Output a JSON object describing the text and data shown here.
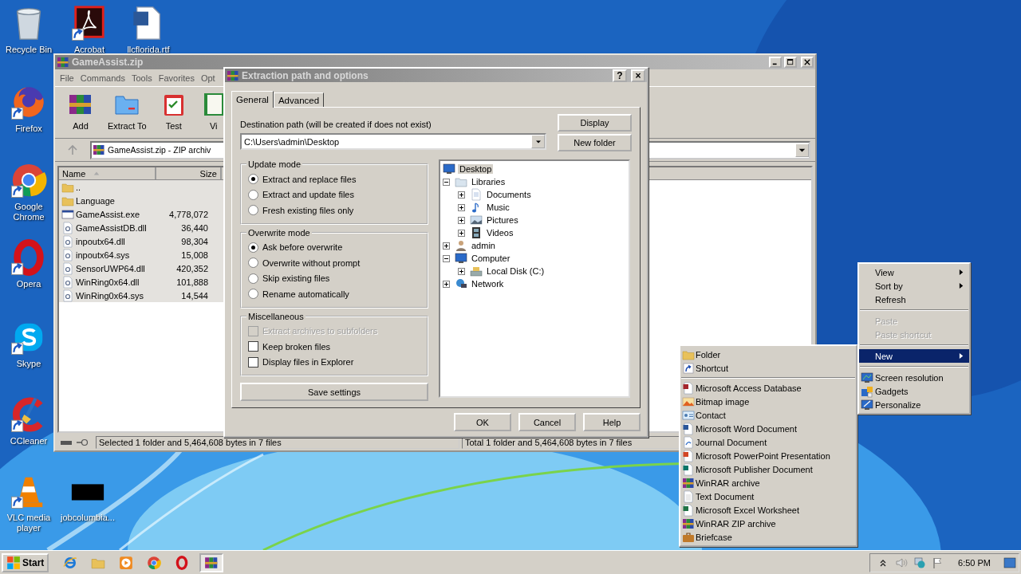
{
  "desktop_icons": [
    {
      "label": "Recycle Bin",
      "kind": "recycle",
      "shortcut": false
    },
    {
      "label": "Acrobat",
      "kind": "acrobat",
      "shortcut": true
    },
    {
      "label": "llcflorida.rtf",
      "kind": "worddoc",
      "shortcut": false
    },
    {
      "label": "Firefox",
      "kind": "firefox",
      "shortcut": true
    },
    {
      "label": "Google Chrome",
      "kind": "chrome",
      "shortcut": true
    },
    {
      "label": "Opera",
      "kind": "opera",
      "shortcut": true
    },
    {
      "label": "Skype",
      "kind": "skype",
      "shortcut": true
    },
    {
      "label": "CCleaner",
      "kind": "ccleaner",
      "shortcut": true
    },
    {
      "label": "VLC media player",
      "kind": "vlc",
      "shortcut": true
    },
    {
      "label": "jobcolumbia...",
      "kind": "thumb",
      "shortcut": false
    }
  ],
  "archive_window": {
    "title": "GameAssist.zip",
    "menu": [
      "File",
      "Commands",
      "Tools",
      "Favorites",
      "Opt"
    ],
    "toolbar": [
      {
        "label": "Add",
        "kind": "add"
      },
      {
        "label": "Extract To",
        "kind": "extract"
      },
      {
        "label": "Test",
        "kind": "test"
      },
      {
        "label": "Vi",
        "kind": "view"
      }
    ],
    "address": "GameAssist.zip - ZIP archiv",
    "columns": [
      {
        "label": "Name",
        "sorted": true
      },
      {
        "label": "Size",
        "sorted": false
      }
    ],
    "files": [
      {
        "name": "..",
        "kind": "folder",
        "selected": true
      },
      {
        "name": "Language",
        "kind": "folder",
        "selected": true
      },
      {
        "name": "GameAssist.exe",
        "size": "4,778,072",
        "kind": "exe",
        "selected": true
      },
      {
        "name": "GameAssistDB.dll",
        "size": "36,440",
        "kind": "dll",
        "selected": true
      },
      {
        "name": "inpoutx64.dll",
        "size": "98,304",
        "kind": "dll",
        "selected": true
      },
      {
        "name": "inpoutx64.sys",
        "size": "15,008",
        "kind": "dll",
        "selected": true
      },
      {
        "name": "SensorUWP64.dll",
        "size": "420,352",
        "kind": "dll",
        "selected": true
      },
      {
        "name": "WinRing0x64.dll",
        "size": "101,888",
        "kind": "dll",
        "selected": true
      },
      {
        "name": "WinRing0x64.sys",
        "size": "14,544",
        "kind": "dll",
        "selected": true
      }
    ],
    "status_left": "Selected 1 folder and 5,464,608 bytes in 7 files",
    "status_right": "Total 1 folder and 5,464,608 bytes in 7 files"
  },
  "dialog": {
    "title": "Extraction path and options",
    "title_buttons": [
      "?",
      "×"
    ],
    "tabs": [
      {
        "label": "General",
        "selected": true
      },
      {
        "label": "Advanced",
        "selected": false
      }
    ],
    "destination_label": "Destination path (will be created if does not exist)",
    "destination": "C:\\Users\\admin\\Desktop",
    "side_buttons": [
      "Display",
      "New folder"
    ],
    "groups": [
      {
        "title": "Update mode",
        "kind": "radio",
        "options": [
          {
            "label": "Extract and replace files",
            "selected": true
          },
          {
            "label": "Extract and update files",
            "selected": false
          },
          {
            "label": "Fresh existing files only",
            "selected": false
          }
        ]
      },
      {
        "title": "Overwrite mode",
        "kind": "radio",
        "options": [
          {
            "label": "Ask before overwrite",
            "selected": true
          },
          {
            "label": "Overwrite without prompt",
            "selected": false
          },
          {
            "label": "Skip existing files",
            "selected": false
          },
          {
            "label": "Rename automatically",
            "selected": false
          }
        ]
      },
      {
        "title": "Miscellaneous",
        "kind": "checkbox",
        "options": [
          {
            "label": "Extract archives to subfolders",
            "checked": false,
            "disabled": true
          },
          {
            "label": "Keep broken files",
            "checked": false,
            "disabled": false
          },
          {
            "label": "Display files in Explorer",
            "checked": false,
            "disabled": false
          }
        ]
      }
    ],
    "save_button": "Save settings",
    "tree": {
      "root": {
        "label": "Desktop",
        "selected": true
      },
      "nodes": [
        {
          "label": "Libraries",
          "kind": "libraries",
          "expanded": true,
          "selected": false,
          "children": [
            {
              "label": "Documents",
              "kind": "documents",
              "expanded": false,
              "selected": false
            },
            {
              "label": "Music",
              "kind": "music",
              "expanded": false,
              "selected": false
            },
            {
              "label": "Pictures",
              "kind": "pictures",
              "expanded": false,
              "selected": false
            },
            {
              "label": "Videos",
              "kind": "videos",
              "expanded": false,
              "selected": false
            }
          ]
        },
        {
          "label": "admin",
          "kind": "user",
          "expanded": false,
          "selected": false
        },
        {
          "label": "Computer",
          "kind": "computer",
          "expanded": true,
          "selected": false,
          "children": [
            {
              "label": "Local Disk (C:)",
              "kind": "disk",
              "expanded": false,
              "selected": false
            }
          ]
        },
        {
          "label": "Network",
          "kind": "network",
          "expanded": false,
          "selected": false
        }
      ]
    },
    "buttons": [
      "OK",
      "Cancel",
      "Help"
    ]
  },
  "context_menu": {
    "items": [
      {
        "label": "View",
        "kind": "plain",
        "submenu": true,
        "selected": false,
        "disabled": false
      },
      {
        "label": "Sort by",
        "kind": "plain",
        "submenu": true,
        "selected": false,
        "disabled": false
      },
      {
        "label": "Refresh",
        "kind": "plain",
        "submenu": false,
        "selected": false,
        "disabled": false
      },
      {
        "kind": "separator"
      },
      {
        "label": "Paste",
        "kind": "plain",
        "submenu": false,
        "selected": false,
        "disabled": true
      },
      {
        "label": "Paste shortcut",
        "kind": "plain",
        "submenu": false,
        "selected": false,
        "disabled": true
      },
      {
        "kind": "separator"
      },
      {
        "label": "New",
        "kind": "plain",
        "submenu": true,
        "selected": true,
        "disabled": false
      },
      {
        "kind": "separator"
      },
      {
        "label": "Screen resolution",
        "kind": "resolution",
        "submenu": false,
        "selected": false,
        "disabled": false
      },
      {
        "label": "Gadgets",
        "kind": "gadgets",
        "submenu": false,
        "selected": false,
        "disabled": false
      },
      {
        "label": "Personalize",
        "kind": "personalize",
        "submenu": false,
        "selected": false,
        "disabled": false
      }
    ]
  },
  "new_submenu": {
    "items": [
      {
        "label": "Folder",
        "kind": "folder"
      },
      {
        "label": "Shortcut",
        "kind": "shortcut"
      },
      {
        "kind": "separator"
      },
      {
        "label": "Microsoft Access Database",
        "kind": "access"
      },
      {
        "label": "Bitmap image",
        "kind": "bitmap"
      },
      {
        "label": "Contact",
        "kind": "contact"
      },
      {
        "label": "Microsoft Word Document",
        "kind": "word"
      },
      {
        "label": "Journal Document",
        "kind": "journal"
      },
      {
        "label": "Microsoft PowerPoint Presentation",
        "kind": "powerpoint"
      },
      {
        "label": "Microsoft Publisher Document",
        "kind": "publisher"
      },
      {
        "label": "WinRAR archive",
        "kind": "winrar"
      },
      {
        "label": "Text Document",
        "kind": "text"
      },
      {
        "label": "Microsoft Excel Worksheet",
        "kind": "excel"
      },
      {
        "label": "WinRAR ZIP archive",
        "kind": "winrar"
      },
      {
        "label": "Briefcase",
        "kind": "briefcase"
      }
    ]
  },
  "taskbar": {
    "start": "Start",
    "apps": [
      {
        "kind": "ie",
        "active": false
      },
      {
        "kind": "explorer",
        "active": false
      },
      {
        "kind": "mediaplayer",
        "active": false
      },
      {
        "kind": "chrome",
        "active": false
      },
      {
        "kind": "opera",
        "active": false
      },
      {
        "kind": "winrar",
        "active": true
      }
    ],
    "tray": [
      {
        "kind": "chevron"
      },
      {
        "kind": "volume"
      },
      {
        "kind": "network"
      },
      {
        "kind": "flag"
      }
    ],
    "clock": "6:50 PM"
  }
}
